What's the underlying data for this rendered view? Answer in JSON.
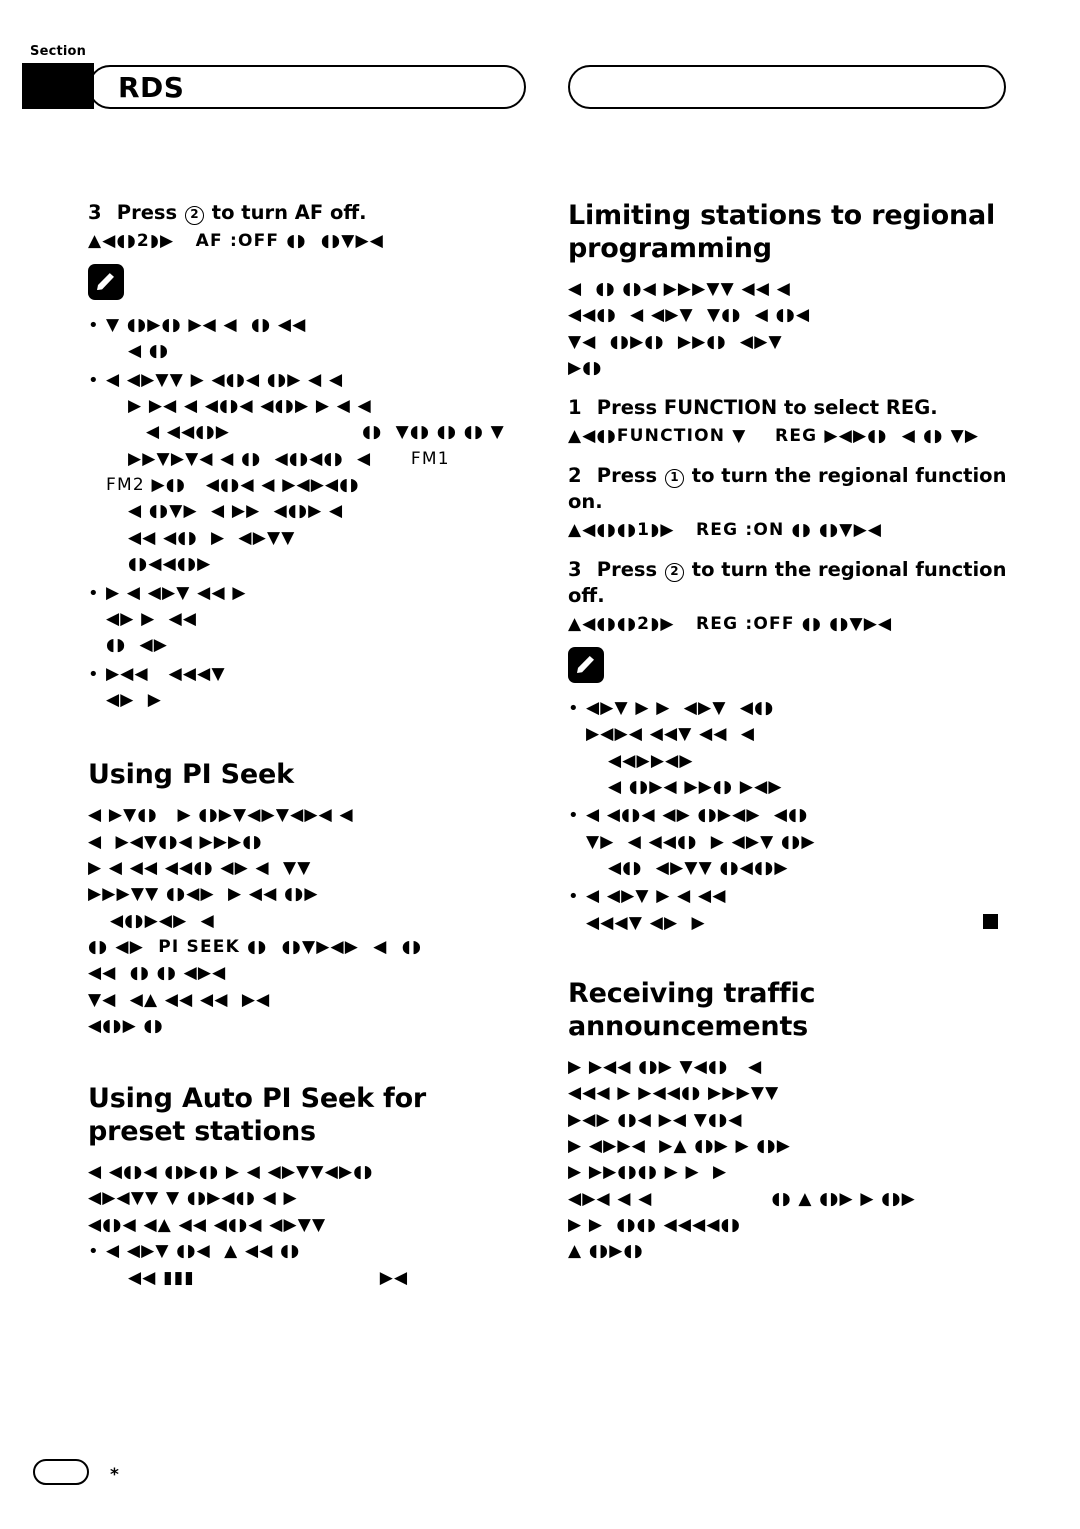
{
  "header": {
    "section_label": "Section",
    "title": "RDS"
  },
  "left_column": {
    "step3": {
      "number": "3",
      "text_before": "Press",
      "circled": "2",
      "text_after": "to turn AF off."
    },
    "step3_display": "▲◀◖◗2◗▶   AF :OFF ◖◗  ◖◗▼▶◀",
    "notes": [
      {
        "lines": [
          "▼ ◖◗▶◖◗ ▶◀ ◀  ◖◗ ◀◀",
          "◀ ◖◗"
        ]
      },
      {
        "lines": [
          "◀ ◀▶▼▼ ▶ ◀◖◗◀ ◖◗▶ ◀ ◀",
          "▶ ▶◀ ◀ ◀◖◗◀ ◀◖◗▶ ▶ ◀ ◀",
          "◀ ◀◀◖◗▶                    ◖◗  ▼◖◗ ◖◗ ◖◗ ▼",
          "▶▶▼▶▼◀ ◀ ◖◗  ◀◖◗◀◖◗  ◀      FM1",
          "FM2 ▶◖◗   ◀◖◗◀ ◀ ▶◀▶◀◖◗",
          "◀ ◖◗▼▶  ◀ ▶▶  ◀◖◗▶ ◀",
          "◀◀ ◀◖◗  ▶  ◀▶▼▼",
          "◖◗◀◀◖◗▶"
        ]
      },
      {
        "lines": [
          "▶ ◀ ◀▶▼ ◀◀ ▶",
          "◀▶ ▶  ◀◀",
          "◖◗  ◀▶"
        ]
      },
      {
        "lines": [
          "▶◀◀   ◀◀◀▼",
          "◀▶  ▶"
        ]
      }
    ],
    "heading_pi_seek": "Using PI Seek",
    "pi_seek_body": [
      "◀ ▶▼◖◗   ▶ ◖◗▶▼◀▶▼◀▶◀ ◀",
      "◀  ▶◀▼◖◗◀ ▶▶▶◖◗",
      "▶ ◀ ◀◀ ◀◀◖◗ ◀▶ ◀  ▼▼",
      "▶▶▶▼▼ ◖◗◀▶  ▶ ◀◀ ◖◗▶",
      "◀◖◗▶◀▶  ◀"
    ],
    "pi_seek_line_code": "◖◗ ◀▶  PI SEEK ◖◗  ◖◗▼▶◀▶  ◀  ◖◗",
    "pi_seek_tail": [
      "◀◀  ◖◗ ◖◗ ◀▶◀",
      "▼◀  ◀▲ ◀◀ ◀◀  ▶◀",
      "◀◖◗▶ ◖◗"
    ],
    "heading_auto_pi_seek": "Using Auto PI Seek for preset stations",
    "auto_pi_seek_body": [
      "◀ ◀◖◗◀ ◖◗▶◖◗ ▶ ◀ ◀▶▼▼◀▶◖◗",
      "◀▶◀▼▼ ▼ ◖◗▶◀◖◗ ◀ ▶",
      "◀◖◗◀ ◀▲ ◀◀ ◀◖◗◀ ◀▶▼▼"
    ],
    "auto_pi_seek_bullet": [
      "◀ ◀▶▼ ◖◗◀  ▲ ◀◀ ◖◗",
      "◀◀ ▮▮▮                            ▶◀"
    ]
  },
  "right_column": {
    "heading_limiting": "Limiting stations to regional programming",
    "limiting_body": [
      "◀  ◖◗ ◖◗◀ ▶▶▶▼▼ ◀◀ ◀",
      "◀◀◖◗  ◀ ◀▶▼  ▼◖◗  ◀ ◖◗◀",
      "▼◀  ◖◗▶◖◗  ▶▶◖◗  ◀▶▼",
      "▶◖◗"
    ],
    "step1": {
      "number": "1",
      "text": "Press FUNCTION to select REG."
    },
    "step1_display": "▲◀◖◗FUNCTION ▼    REG ▶◀▶◖◗  ◀ ◖◗ ▼▶",
    "step2": {
      "number": "2",
      "text_before": "Press",
      "circled": "1",
      "text_after": "to turn the regional function on."
    },
    "step2_display": "▲◀◖◗◖◗1◗▶   REG :ON ◖◗ ◖◗▼▶◀",
    "step3": {
      "number": "3",
      "text_before": "Press",
      "circled": "2",
      "text_after": "to turn the regional function off."
    },
    "step3_display": "▲◀◖◗◖◗2◗▶   REG :OFF ◖◗ ◖◗▼▶◀",
    "notes": [
      {
        "lines": [
          "◀▶▼ ▶ ▶  ◀▶▼  ◀◖◗",
          "▶◀▶◀ ◀◀▼ ◀◀  ◀",
          "◀◀▶▶◀▶",
          "◀ ◖◗▶◀ ▶▶◖◗ ▶◀▶"
        ]
      },
      {
        "lines": [
          "◀ ◀◖◗◀ ◀▶ ◖◗▶◀▶  ◀◖◗",
          "▼▶  ◀ ◀◀◖◗  ▶ ◀▶▼ ◖◗▶",
          "◀◖◗  ◀▶▼▼ ◖◗◀◖◗▶"
        ]
      },
      {
        "lines": [
          "◀ ◀▶▼ ▶ ◀ ◀◀",
          "◀◀◀▼ ◀▶  ▶"
        ]
      }
    ],
    "heading_traffic": "Receiving traffic announcements",
    "traffic_body": [
      "▶ ▶◀◀ ◖◗▶ ▼◀◖◗   ◀",
      "◀◀◀ ▶ ▶◀◀◖◗ ▶▶▶▼▼",
      "▶◀▶ ◖◗◀ ▶◀ ▼◖◗◀",
      "▶ ◀▶▶◀  ▶▲ ◖◗▶ ▶ ◖◗▶",
      "▶ ▶▶◖◗◖◗ ▶ ▶  ▶",
      "◀▶◀ ◀ ◀                  ◖◗ ▲ ◖◗▶ ▶ ◖◗▶",
      "▶ ▶  ◖◗◖◗ ◀◀◀◀◖◗",
      "▲ ◖◗▶◖◗"
    ]
  },
  "footer": {
    "star": "*"
  }
}
